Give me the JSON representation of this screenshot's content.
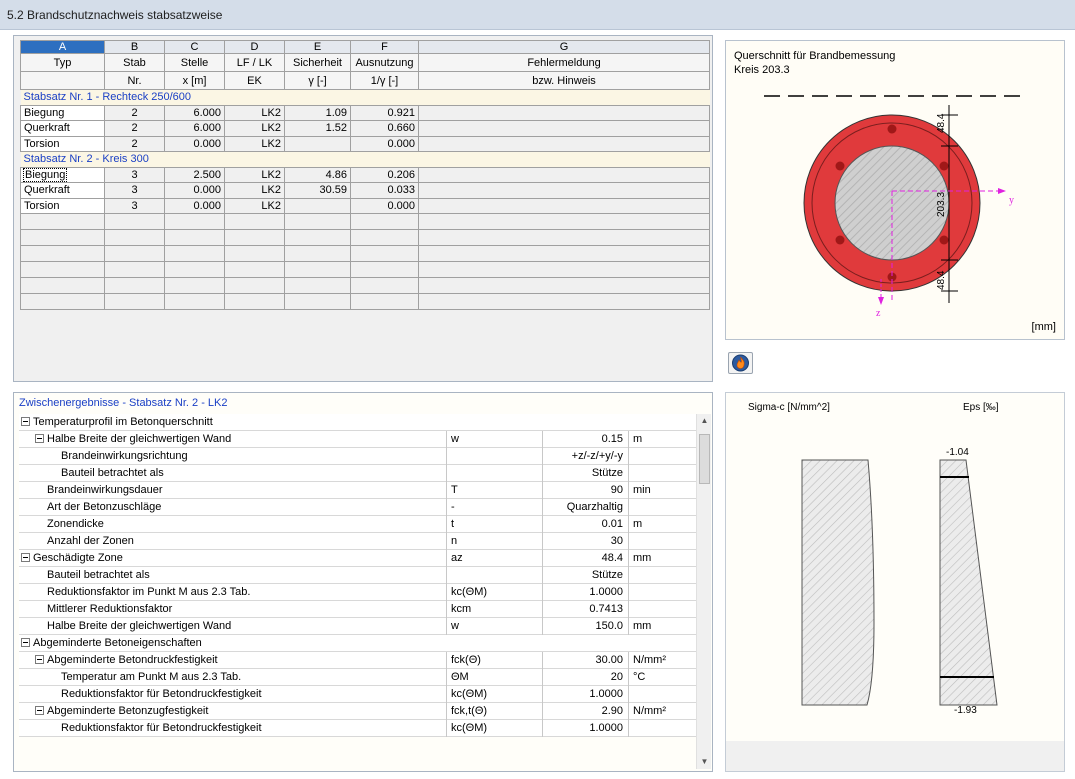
{
  "window": {
    "title": "5.2 Brandschutznachweis stabsatzweise"
  },
  "table": {
    "letters": [
      "A",
      "B",
      "C",
      "D",
      "E",
      "F",
      "G"
    ],
    "head1": [
      "Typ",
      "Stab",
      "Stelle",
      "LF / LK",
      "Sicherheit",
      "Ausnutzung",
      "Fehlermeldung"
    ],
    "head2": [
      "",
      "Nr.",
      "x [m]",
      "EK",
      "γ [-]",
      "1/γ [-]",
      "bzw. Hinweis"
    ],
    "groups": [
      {
        "label": "Stabsatz Nr. 1  -  Rechteck 250/600",
        "rows": [
          {
            "typ": "Biegung",
            "stab": "2",
            "stelle": "6.000",
            "lk": "LK2",
            "sicherheit": "1.09",
            "ausnutzung": "0.921",
            "hinweis": ""
          },
          {
            "typ": "Querkraft",
            "stab": "2",
            "stelle": "6.000",
            "lk": "LK2",
            "sicherheit": "1.52",
            "ausnutzung": "0.660",
            "hinweis": ""
          },
          {
            "typ": "Torsion",
            "stab": "2",
            "stelle": "0.000",
            "lk": "LK2",
            "sicherheit": "",
            "ausnutzung": "0.000",
            "hinweis": ""
          }
        ]
      },
      {
        "label": "Stabsatz Nr. 2  -  Kreis 300",
        "rows": [
          {
            "typ": "Biegung",
            "stab": "3",
            "stelle": "2.500",
            "lk": "LK2",
            "sicherheit": "4.86",
            "ausnutzung": "0.206",
            "hinweis": ""
          },
          {
            "typ": "Querkraft",
            "stab": "3",
            "stelle": "0.000",
            "lk": "LK2",
            "sicherheit": "30.59",
            "ausnutzung": "0.033",
            "hinweis": ""
          },
          {
            "typ": "Torsion",
            "stab": "3",
            "stelle": "0.000",
            "lk": "LK2",
            "sicherheit": "",
            "ausnutzung": "0.000",
            "hinweis": ""
          }
        ]
      }
    ]
  },
  "section": {
    "title": "Querschnitt für Brandbemessung",
    "subtitle": "Kreis 203.3",
    "dim_top": "48.4",
    "dim_mid": "203.3",
    "dim_bottom": "48.4",
    "axis_y": "y",
    "axis_z": "z",
    "unit": "[mm]"
  },
  "colors": {
    "fire_zone": "#e03a3c",
    "core": "#c8c8c8",
    "rebar": "#a01818",
    "axis": "#e020e0",
    "selection": "#2d6fc0",
    "group_text": "#1a3fc5"
  },
  "intermediate": {
    "header": "Zwischenergebnisse  -  Stabsatz Nr. 2  -  LK2",
    "rows": [
      {
        "level": 0,
        "section": true,
        "label": "Temperaturprofil im Betonquerschnitt"
      },
      {
        "level": 1,
        "expander": true,
        "label": "Halbe Breite der gleichwertigen Wand",
        "symbol": "w",
        "value": "0.15",
        "unit": "m"
      },
      {
        "level": 2,
        "label": "Brandeinwirkungsrichtung",
        "symbol": "",
        "value": "+z/-z/+y/-y",
        "unit": ""
      },
      {
        "level": 2,
        "label": "Bauteil betrachtet als",
        "symbol": "",
        "value": "Stütze",
        "unit": ""
      },
      {
        "level": 1,
        "label": "Brandeinwirkungsdauer",
        "symbol": "T",
        "value": "90",
        "unit": "min"
      },
      {
        "level": 1,
        "label": "Art der Betonzuschläge",
        "symbol": "-",
        "value": "Quarzhaltig",
        "unit": ""
      },
      {
        "level": 1,
        "label": "Zonendicke",
        "symbol": "t",
        "value": "0.01",
        "unit": "m"
      },
      {
        "level": 1,
        "label": "Anzahl der Zonen",
        "symbol": "n",
        "value": "30",
        "unit": ""
      },
      {
        "level": 0,
        "expander": true,
        "label": "Geschädigte Zone",
        "symbol": "aᴢ",
        "value": "48.4",
        "unit": "mm"
      },
      {
        "level": 1,
        "label": "Bauteil betrachtet als",
        "symbol": "",
        "value": "Stütze",
        "unit": ""
      },
      {
        "level": 1,
        "label": "Reduktionsfaktor im Punkt M aus 2.3 Tab.",
        "symbol": "kc(ΘM)",
        "value": "1.0000",
        "unit": ""
      },
      {
        "level": 1,
        "label": "Mittlerer Reduktionsfaktor",
        "symbol": "kcm",
        "value": "0.7413",
        "unit": ""
      },
      {
        "level": 1,
        "label": "Halbe Breite der gleichwertigen Wand",
        "symbol": "w",
        "value": "150.0",
        "unit": "mm"
      },
      {
        "level": 0,
        "section": true,
        "label": "Abgeminderte Betoneigenschaften"
      },
      {
        "level": 1,
        "expander": true,
        "label": "Abgeminderte Betondruckfestigkeit",
        "symbol": "fck(Θ)",
        "value": "30.00",
        "unit": "N/mm²"
      },
      {
        "level": 2,
        "label": "Temperatur am Punkt M aus 2.3 Tab.",
        "symbol": "ΘM",
        "value": "20",
        "unit": "°C"
      },
      {
        "level": 2,
        "label": "Reduktionsfaktor für Betondruckfestigkeit",
        "symbol": "kc(ΘM)",
        "value": "1.0000",
        "unit": ""
      },
      {
        "level": 1,
        "expander": true,
        "label": "Abgeminderte Betonzugfestigkeit",
        "symbol": "fck,t(Θ)",
        "value": "2.90",
        "unit": "N/mm²"
      },
      {
        "level": 2,
        "label": "Reduktionsfaktor für Betondruckfestigkeit",
        "symbol": "kc(ΘM)",
        "value": "1.0000",
        "unit": ""
      }
    ]
  },
  "stress": {
    "sigma_label": "Sigma-c [N/mm^2]",
    "eps_label": "Eps [‰]",
    "eps_top": "-1.04",
    "eps_bottom": "-1.93"
  },
  "icons": {
    "fire_button": "fire-icon",
    "scroll_up": "arrow-up-icon",
    "scroll_down": "arrow-down-icon"
  }
}
